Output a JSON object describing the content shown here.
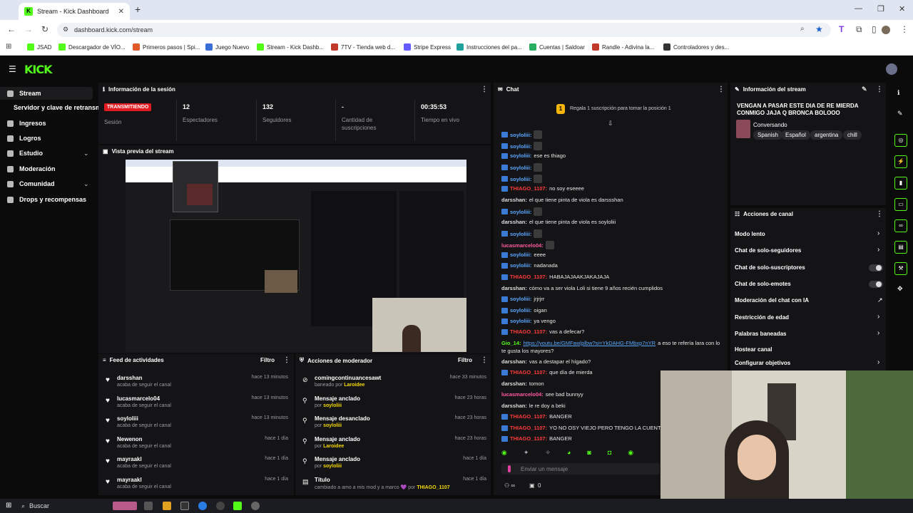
{
  "browser": {
    "tab_title": "Stream - Kick Dashboard",
    "url": "dashboard.kick.com/stream",
    "bookmarks": [
      "JSAD",
      "Descargador de VÍO...",
      "Primeros pasos | Spi...",
      "Juego Nuevo",
      "Stream - Kick Dashb...",
      "7TV - Tienda web d...",
      "Stripe Express",
      "Instrucciones del pa...",
      "Cuentas | Saldoar",
      "Randle - Adivina la...",
      "Controladores y des..."
    ]
  },
  "brand": {
    "logo": "KICK",
    "accent": "#53fc18"
  },
  "sidebar": {
    "items": [
      {
        "label": "Stream"
      },
      {
        "label": "Servidor y clave de retransmisión"
      },
      {
        "label": "Ingresos"
      },
      {
        "label": "Logros"
      },
      {
        "label": "Estudio"
      },
      {
        "label": "Moderación"
      },
      {
        "label": "Comunidad"
      },
      {
        "label": "Drops y recompensas"
      }
    ]
  },
  "session": {
    "title": "Información de la sesión",
    "status": "TRANSMITIENDO",
    "session_label": "Sesión",
    "viewers": "12",
    "viewers_label": "Espectadores",
    "followers": "132",
    "followers_label": "Seguidores",
    "subs": "-",
    "subs_label": "Cantidad de suscripciones",
    "time": "00:35:53",
    "time_label": "Tiempo en vivo"
  },
  "preview": {
    "title": "Vista previa del stream"
  },
  "activity": {
    "title": "Feed de actividades",
    "filter": "Filtro",
    "rows": [
      {
        "name": "darsshan",
        "sub": "acaba de seguir el canal",
        "time": "hace 13 minutos"
      },
      {
        "name": "lucasmarcelo04",
        "sub": "acaba de seguir el canal",
        "time": "hace 13 minutos"
      },
      {
        "name": "soyloliii",
        "sub": "acaba de seguir el canal",
        "time": "hace 13 minutos"
      },
      {
        "name": "Newenon",
        "sub": "acaba de seguir el canal",
        "time": "hace 1 día"
      },
      {
        "name": "mayraakl",
        "sub": "acaba de seguir el canal",
        "time": "hace 1 día"
      },
      {
        "name": "mayraakl",
        "sub": "acaba de seguir el canal",
        "time": "hace 1 día"
      }
    ]
  },
  "mod": {
    "title": "Acciones de moderador",
    "filter": "Filtro",
    "rows": [
      {
        "name": "comingcontinuancesawt",
        "sub_pre": "baneado por ",
        "sub_user": "Laroidee",
        "time": "hace 33 minutos"
      },
      {
        "name": "Mensaje anclado",
        "sub_pre": "por ",
        "sub_user": "soyloliii",
        "time": "hace 23 horas"
      },
      {
        "name": "Mensaje desanclado",
        "sub_pre": "por ",
        "sub_user": "soyloliii",
        "time": "hace 23 horas"
      },
      {
        "name": "Mensaje anclado",
        "sub_pre": "por ",
        "sub_user": "Laroidee",
        "time": "hace 23 horas"
      },
      {
        "name": "Mensaje anclado",
        "sub_pre": "por ",
        "sub_user": "soyloliii",
        "time": "hace 1 día"
      },
      {
        "name": "Título",
        "sub_pre": "cambiado a amo a mis mod y a marco 💜 por ",
        "sub_user": "THIAGO_1107",
        "time": "hace 1 día"
      }
    ]
  },
  "chat": {
    "title": "Chat",
    "promo": "Regala 1 suscripción para tomar la posición 1",
    "messages": [
      {
        "user": "soyloliii:",
        "text": "",
        "color": "blue"
      },
      {
        "user": "soyloliii:",
        "text": "",
        "color": "blue"
      },
      {
        "user": "soyloliii:",
        "text": "ese es thiago",
        "color": "blue"
      },
      {
        "user": "soyloliii:",
        "text": "",
        "color": "blue"
      },
      {
        "user": "soyloliii:",
        "text": "",
        "color": "blue"
      },
      {
        "user": "THIAGO_1107:",
        "text": "no soy eseeee",
        "color": "red"
      },
      {
        "user": "darsshan:",
        "text": "el que tiene pinta de viola es darssshan",
        "color": "plain"
      },
      {
        "user": "soyloliii:",
        "text": "",
        "color": "blue"
      },
      {
        "user": "darsshan:",
        "text": "el que tiene pinta de viola es soyloliii",
        "color": "plain"
      },
      {
        "user": "soyloliii:",
        "text": "",
        "color": "blue"
      },
      {
        "user": "lucasmarcelo04:",
        "text": "",
        "color": "pink"
      },
      {
        "user": "soyloliii:",
        "text": "eeee",
        "color": "blue"
      },
      {
        "user": "soyloliii:",
        "text": "nadanada",
        "color": "blue"
      },
      {
        "user": "THIAGO_1107:",
        "text": "HABAJAJAAKJAKAJAJA",
        "color": "red"
      },
      {
        "user": "darsshan:",
        "text": "cómo va a ser viola Loli si tiene 9 años recién cumplidos",
        "color": "plain"
      },
      {
        "user": "soyloliii:",
        "text": "jrjrjrr",
        "color": "blue"
      },
      {
        "user": "soyloliii:",
        "text": "oigan",
        "color": "blue"
      },
      {
        "user": "soyloliii:",
        "text": "ya vengo",
        "color": "blue"
      },
      {
        "user": "THIAGO_1107:",
        "text": "vas a defecar?",
        "color": "red"
      },
      {
        "user": "Gio_14:",
        "text": "https://youtu.be/GMFaw|plbw?si=YkDAHG-FMbxp7nYR",
        "text2": " a eso te refería lara con lo",
        "color": "grn"
      },
      {
        "user": "",
        "text": "te gusta los mayores?",
        "color": "plain"
      },
      {
        "user": "darsshan:",
        "text": "vas a destapar el hígado?",
        "color": "plain"
      },
      {
        "user": "THIAGO_1107:",
        "text": "que día de mierda",
        "color": "red"
      },
      {
        "user": "darsshan:",
        "text": "tomon",
        "color": "plain"
      },
      {
        "user": "lucasmarcelo04:",
        "text": "see bad bunnyy",
        "color": "pink"
      },
      {
        "user": "darsshan:",
        "text": "le re doy a beki",
        "color": "plain"
      },
      {
        "user": "THIAGO_1107:",
        "text": "BANGER",
        "color": "red"
      },
      {
        "user": "THIAGO_1107:",
        "text": "YO NO OSY VIEJO PERO TENGO LA CUENTA CON",
        "color": "red"
      },
      {
        "user": "THIAGO_1107:",
        "text": "BANGER",
        "color": "red"
      }
    ],
    "input_placeholder": "Enviar un mensaje",
    "viewers_icon_value": "∞",
    "gift_count": "0"
  },
  "stream_info": {
    "title": "Información del stream",
    "stream_title": "VENGAN A PASAR ESTE DIA DE RE MIERDA CONMIGO JAJA Q BRONCA BOLOOO",
    "category": "Conversando",
    "tags": [
      "Spanish",
      "Español",
      "argentina",
      "chill"
    ]
  },
  "channel_actions": {
    "title": "Acciones de canal",
    "items": [
      {
        "label": "Modo lento",
        "kind": "arrow"
      },
      {
        "label": "Chat de solo-seguidores",
        "kind": "arrow"
      },
      {
        "label": "Chat de solo-suscriptores",
        "kind": "toggle"
      },
      {
        "label": "Chat de solo-emotes",
        "kind": "toggle"
      },
      {
        "label": "Moderación del chat con IA",
        "kind": "ext"
      },
      {
        "label": "Restricción de edad",
        "kind": "arrow"
      },
      {
        "label": "Palabras baneadas",
        "kind": "arrow"
      },
      {
        "label": "Hostear canal",
        "kind": "arrow"
      },
      {
        "label": "Configurar objetivos",
        "kind": "arrow"
      }
    ]
  },
  "taskbar": {
    "search": "Buscar"
  }
}
